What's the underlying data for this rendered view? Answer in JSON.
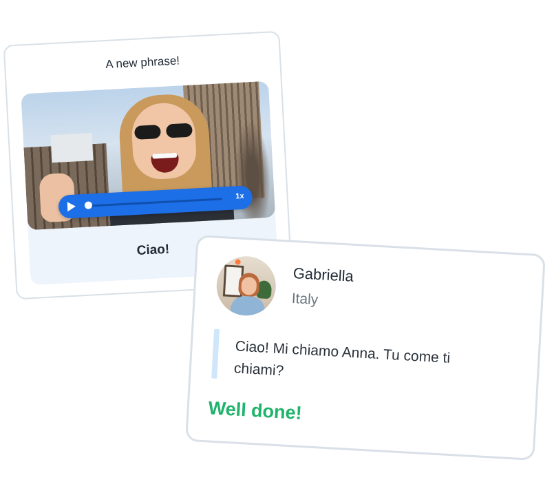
{
  "phrase_card": {
    "title": "A new phrase!",
    "phrase": "Ciao!",
    "player": {
      "speed_label": "1x",
      "progress": 0.0
    }
  },
  "chat_card": {
    "name": "Gabriella",
    "country": "Italy",
    "message": "Ciao! Mi chiamo Anna. Tu come ti chiami?",
    "feedback": "Well done!"
  },
  "colors": {
    "accent_blue": "#1c6fe6",
    "success_green": "#1fb36b",
    "card_border": "#d9e0e7",
    "quote_bar": "#cfe6fb",
    "status_dot": "#ff7a3d"
  },
  "icons": {
    "play": "play-icon",
    "status": "online-dot-icon"
  }
}
